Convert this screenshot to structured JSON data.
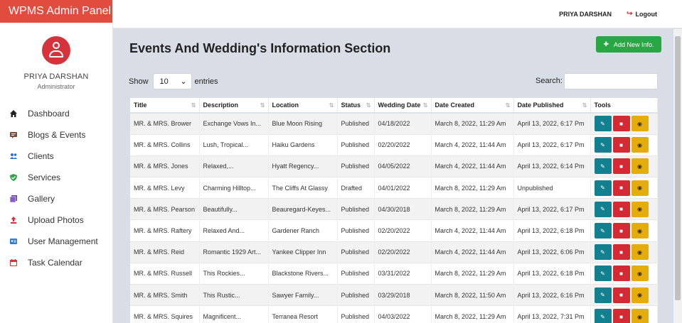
{
  "brand": "WPMS Admin Panel",
  "profile": {
    "name": "PRIYA DARSHAN",
    "role": "Administrator"
  },
  "nav": [
    {
      "label": "Dashboard",
      "icon": "home-icon",
      "color": "#222222"
    },
    {
      "label": "Blogs & Events",
      "icon": "blog-icon",
      "color": "#7a4a3a"
    },
    {
      "label": "Clients",
      "icon": "users-icon",
      "color": "#2d6fd1"
    },
    {
      "label": "Services",
      "icon": "shield-check-icon",
      "color": "#2ea34a"
    },
    {
      "label": "Gallery",
      "icon": "images-icon",
      "color": "#6b3fa0"
    },
    {
      "label": "Upload Photos",
      "icon": "upload-icon",
      "color": "#d6323c"
    },
    {
      "label": "User Management",
      "icon": "id-card-icon",
      "color": "#2d7fd1"
    },
    {
      "label": "Task Calendar",
      "icon": "calendar-icon",
      "color": "#d6323c"
    }
  ],
  "topbar": {
    "user": "PRIYA DARSHAN",
    "logout": "Logout"
  },
  "page": {
    "title": "Events And Wedding's Information Section",
    "add_button": "Add New Info.",
    "show_label": "Show",
    "entries_value": "10",
    "entries_label": "entries",
    "search_label": "Search:",
    "search_value": ""
  },
  "table": {
    "headers": [
      "Title",
      "Description",
      "Location",
      "Status",
      "Wedding Date",
      "Date Created",
      "Date Published",
      "Tools"
    ],
    "rows": [
      [
        "MR. & MRS. Brower",
        "Exchange Vows In...",
        "Blue Moon Rising",
        "Published",
        "04/18/2022",
        "March 8, 2022, 11:29 Am",
        "April 13, 2022, 6:17 Pm"
      ],
      [
        "MR. & MRS. Collins",
        "Lush, Tropical...",
        "Haiku Gardens",
        "Published",
        "02/20/2022",
        "March 4, 2022, 11:44 Am",
        "April 13, 2022, 6:17 Pm"
      ],
      [
        "MR. & MRS. Jones",
        "Relaxed,...",
        "Hyatt Regency...",
        "Published",
        "04/05/2022",
        "March 4, 2022, 11:44 Am",
        "April 13, 2022, 6:14 Pm"
      ],
      [
        "MR. & MRS. Levy",
        "Charming Hilltop...",
        "The Cliffs At Glassy",
        "Drafted",
        "04/01/2022",
        "March 8, 2022, 11:29 Am",
        "Unpublished"
      ],
      [
        "MR. & MRS. Pearson",
        "Beautifully...",
        "Beauregard-Keyes...",
        "Published",
        "04/30/2018",
        "March 8, 2022, 11:29 Am",
        "April 13, 2022, 6:17 Pm"
      ],
      [
        "MR. & MRS. Raftery",
        "Relaxed And...",
        "Gardener Ranch",
        "Published",
        "02/20/2022",
        "March 4, 2022, 11:44 Am",
        "April 13, 2022, 6:18 Pm"
      ],
      [
        "MR. & MRS. Reid",
        "Romantic 1929 Art...",
        "Yankee Clipper Inn",
        "Published",
        "02/20/2022",
        "March 4, 2022, 11:44 Am",
        "April 13, 2022, 6:06 Pm"
      ],
      [
        "MR. & MRS. Russell",
        "This Rockies...",
        "Blackstone Rivers...",
        "Published",
        "03/31/2022",
        "March 8, 2022, 11:29 Am",
        "April 13, 2022, 6:18 Pm"
      ],
      [
        "MR. & MRS. Smith",
        "This Rustic...",
        "Sawyer Family...",
        "Published",
        "03/29/2018",
        "March 8, 2022, 11:50 Am",
        "April 13, 2022, 6:16 Pm"
      ],
      [
        "MR. & MRS. Squires",
        "Magnificent...",
        "Terranea Resort",
        "Published",
        "04/03/2022",
        "March 8, 2022, 11:29 Am",
        "April 13, 2022, 7:31 Pm"
      ]
    ],
    "tools": [
      {
        "name": "edit-button",
        "icon": "edit-user-icon",
        "color": "#13808f"
      },
      {
        "name": "delete-button",
        "icon": "trash-icon",
        "color": "#d42a33"
      },
      {
        "name": "view-button",
        "icon": "eye-icon",
        "color": "#e4ad0c"
      }
    ]
  },
  "colors": {
    "brand": "#e24c3f",
    "accent_green": "#29a745",
    "background": "#d8dde6"
  }
}
